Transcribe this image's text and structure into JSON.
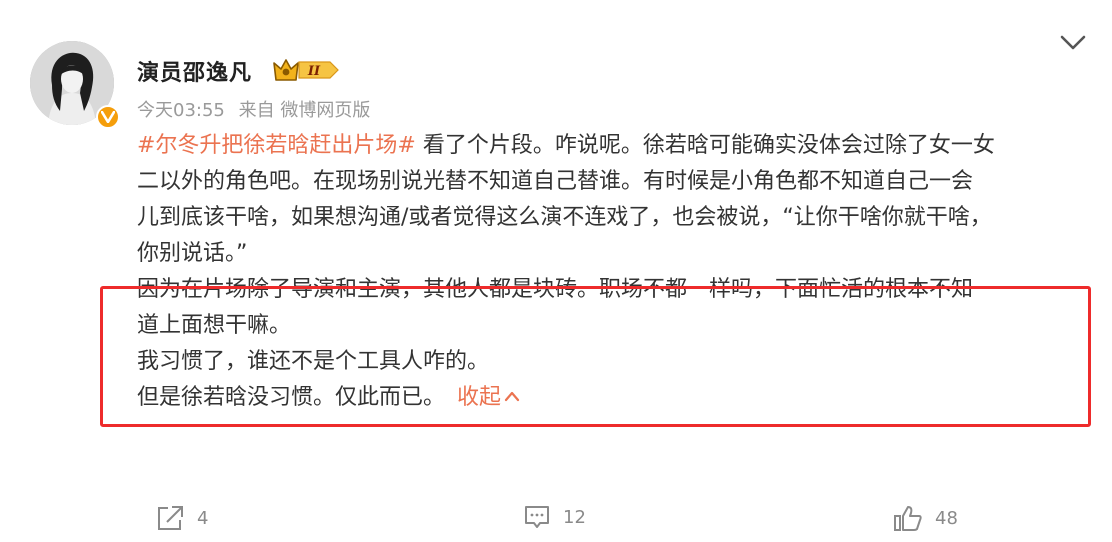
{
  "author": {
    "name": "演员邵逸凡",
    "avatar_icon": "user-avatar",
    "verified_icon": "verified-v-icon",
    "verified_color": "#f59e0b",
    "vip_badge_icon": "crown-level-badge",
    "vip_badge_text": "II"
  },
  "meta": {
    "time": "今天03:55",
    "source": "来自 微博网页版"
  },
  "post": {
    "hashtag": "#尔冬升把徐若晗赶出片场#",
    "line1_rest": " 看了个片段。咋说呢。徐若晗可能确实没体会过除了女一女",
    "line2": "二以外的角色吧。在现场别说光替不知道自己替谁。有时候是小角色都不知道自己一会",
    "line3": "儿到底该干啥，如果想沟通/或者觉得这么演不连戏了，也会被说，“让你干啥你就干啥，",
    "line4": "你别说话。”",
    "line5": "因为在片场除了导演和主演，其他人都是块砖。职场不都一样吗，下面忙活的根本不知",
    "line6": "道上面想干嘛。",
    "line7": "我习惯了，谁还不是个工具人咋的。",
    "line8": "但是徐若晗没习惯。仅此而已。",
    "collapse_label": "收起",
    "collapse_icon": "chevron-up-icon",
    "accent_color": "#eb7350",
    "highlight_color": "#ee2b2b"
  },
  "actions": {
    "repost_count": "4",
    "comment_count": "12",
    "like_count": "48",
    "repost_icon": "share-icon",
    "comment_icon": "comment-icon",
    "like_icon": "thumbs-up-icon"
  },
  "header": {
    "collapse_icon": "chevron-down-icon"
  }
}
